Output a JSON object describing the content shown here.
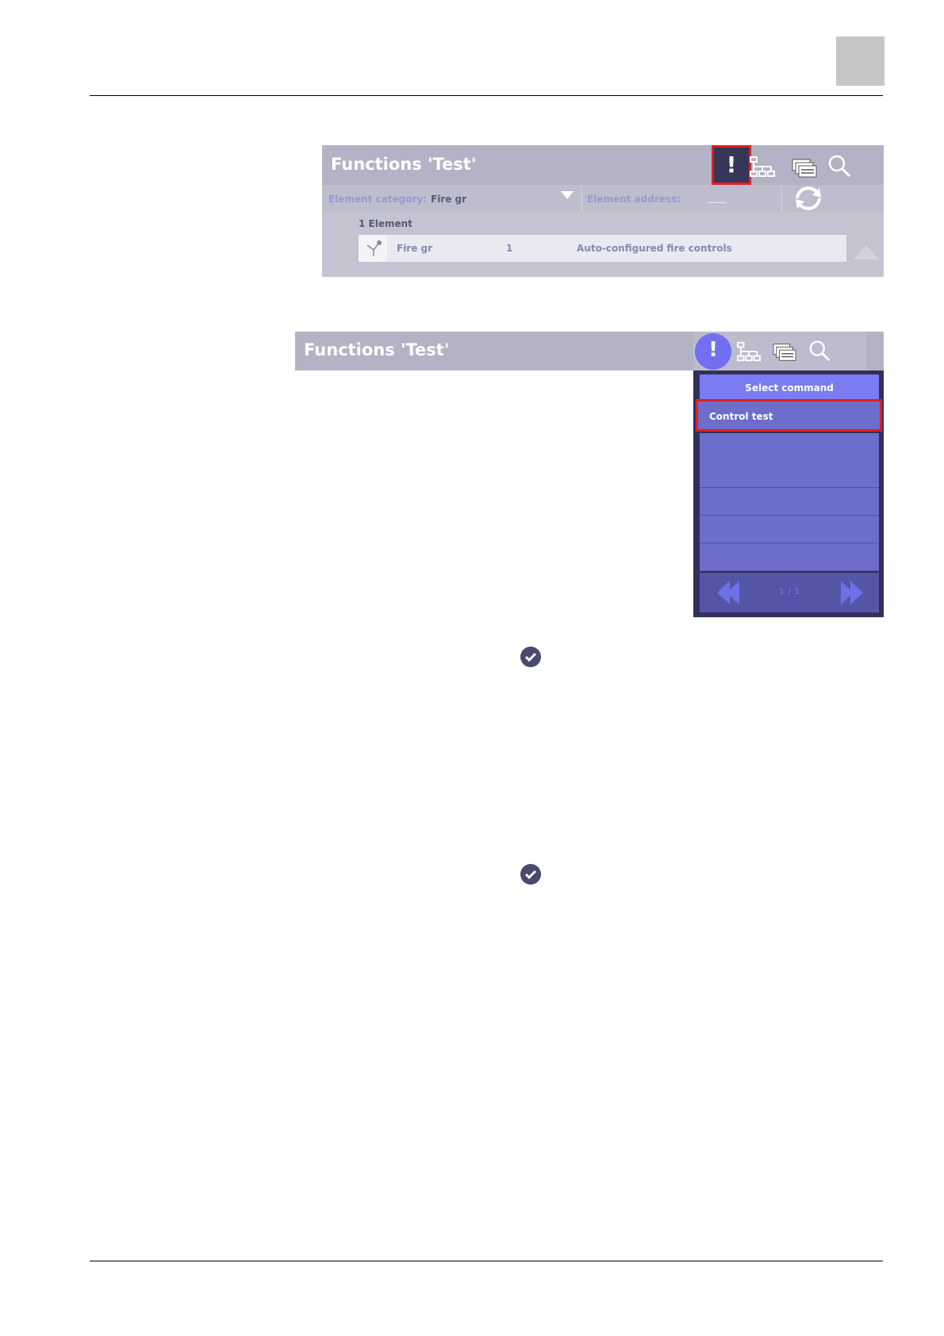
{
  "screen1": {
    "title": "Functions 'Test'",
    "alert_symbol": "!",
    "filter": {
      "category_label": "Element category:",
      "category_value": "Fire gr",
      "address_label": "Element address:",
      "address_value": "____"
    },
    "element_count": "1 Element",
    "row": {
      "name": "Fire gr",
      "number": "1",
      "description": "Auto-configured fire controls"
    },
    "icons": [
      "alert-icon",
      "tree-icon",
      "list-icon",
      "search-icon",
      "refresh-icon",
      "fire-control-icon",
      "scroll-up-icon"
    ]
  },
  "screen2": {
    "title": "Functions 'Test'",
    "alert_symbol": "!",
    "menu": {
      "header": "Select command",
      "items": [
        "Control test",
        "",
        "",
        "",
        "",
        ""
      ],
      "page": "1 / 1"
    },
    "icons": [
      "alert-icon",
      "tree-icon",
      "list-icon",
      "search-icon",
      "prev-page-icon",
      "next-page-icon"
    ]
  },
  "colors": {
    "highlight": "#e02020",
    "accent": "#7b7bf2",
    "header": "#b3b3c5"
  }
}
